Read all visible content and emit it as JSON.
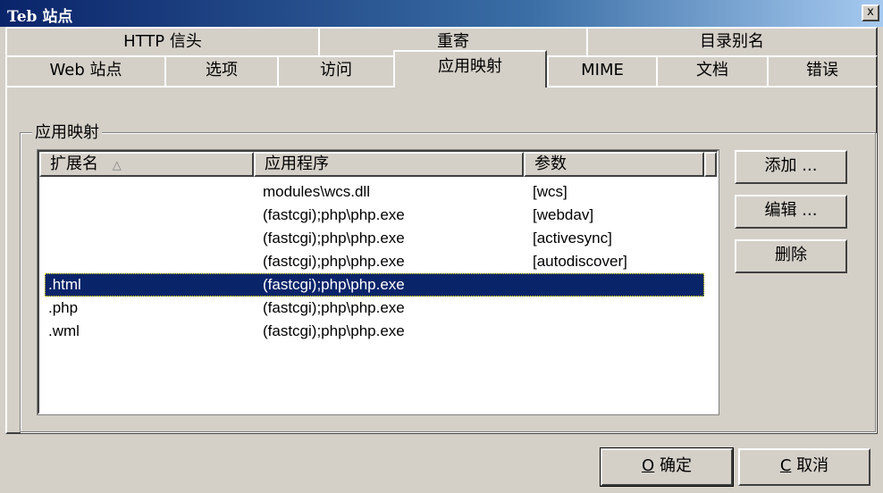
{
  "window": {
    "title": "Teb 站点",
    "close_glyph": "x"
  },
  "tabs": {
    "row1": [
      {
        "label": "HTTP 信头"
      },
      {
        "label": "重寄"
      },
      {
        "label": "目录别名"
      }
    ],
    "row2": [
      {
        "label": "Web 站点"
      },
      {
        "label": "选项"
      },
      {
        "label": "访问"
      },
      {
        "label": "应用映射",
        "active": true
      },
      {
        "label": "MIME"
      },
      {
        "label": "文档"
      },
      {
        "label": "错误"
      }
    ]
  },
  "group": {
    "title": "应用映射"
  },
  "list": {
    "columns": [
      "扩展名",
      "应用程序",
      "参数"
    ],
    "sort_indicator": "△",
    "rows": [
      {
        "ext": "",
        "app": "modules\\wcs.dll",
        "param": "[wcs]"
      },
      {
        "ext": "",
        "app": "(fastcgi);php\\php.exe",
        "param": "[webdav]"
      },
      {
        "ext": "",
        "app": "(fastcgi);php\\php.exe",
        "param": "[activesync]"
      },
      {
        "ext": "",
        "app": "(fastcgi);php\\php.exe",
        "param": "[autodiscover]"
      },
      {
        "ext": ".html",
        "app": "(fastcgi);php\\php.exe",
        "param": "",
        "selected": true
      },
      {
        "ext": ".php",
        "app": "(fastcgi);php\\php.exe",
        "param": ""
      },
      {
        "ext": ".wml",
        "app": "(fastcgi);php\\php.exe",
        "param": ""
      }
    ]
  },
  "side_buttons": {
    "add": "添加 ...",
    "edit": "编辑 ...",
    "delete": "删除"
  },
  "bottom_buttons": {
    "ok_mnemonic": "O",
    "ok_label": " 确定",
    "cancel_mnemonic": "C",
    "cancel_label": " 取消"
  },
  "colors": {
    "selection": "#0a246a",
    "face": "#d4d0c8",
    "title_start": "#0a246a",
    "title_end": "#a6caf0"
  }
}
